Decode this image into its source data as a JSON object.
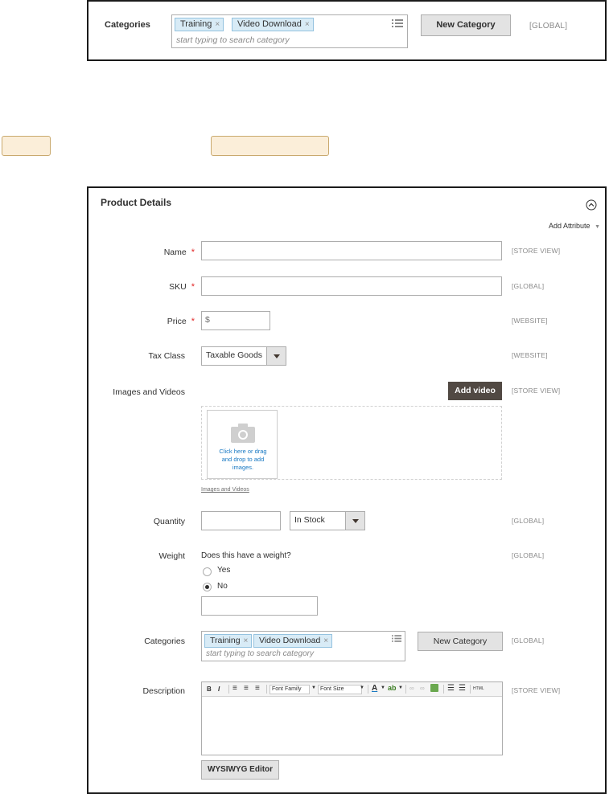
{
  "top_panel": {
    "label": "Categories",
    "tags": [
      "Training",
      "Video Download"
    ],
    "placeholder": "start typing to search category",
    "new_category": "New Category",
    "scope": "[GLOBAL]"
  },
  "product_details": {
    "title": "Product Details",
    "add_attribute": "Add Attribute",
    "name_label": "Name",
    "name_scope": "[STORE VIEW]",
    "sku_label": "SKU",
    "sku_scope": "[GLOBAL]",
    "price_label": "Price",
    "price_prefix": "$",
    "price_scope": "[WEBSITE]",
    "tax_label": "Tax Class",
    "tax_value": "Taxable Goods",
    "tax_scope": "[WEBSITE]",
    "images_label": "Images and Videos",
    "add_video": "Add video",
    "images_scope": "[STORE VIEW]",
    "upload_text": "Click here or drag and drop to add images.",
    "images_link": "Images and Videos",
    "quantity_label": "Quantity",
    "stock_value": "In Stock",
    "quantity_scope": "[GLOBAL]",
    "weight_label": "Weight",
    "weight_question": "Does this have a weight?",
    "weight_yes": "Yes",
    "weight_no": "No",
    "weight_scope": "[GLOBAL]",
    "categories_label": "Categories",
    "category_tags": [
      "Training",
      "Video Download"
    ],
    "categories_placeholder": "start typing to search category",
    "new_category": "New Category",
    "categories_scope": "[GLOBAL]",
    "description_label": "Description",
    "description_scope": "[STORE VIEW]",
    "font_family": "Font Family",
    "font_size": "Font Size",
    "wysiwyg": "WYSIWYG Editor"
  },
  "colors": {
    "tag_bg": "#d8ebf6",
    "required": "#e22626",
    "dark_button": "#514943",
    "upload_link": "#1979c3"
  }
}
